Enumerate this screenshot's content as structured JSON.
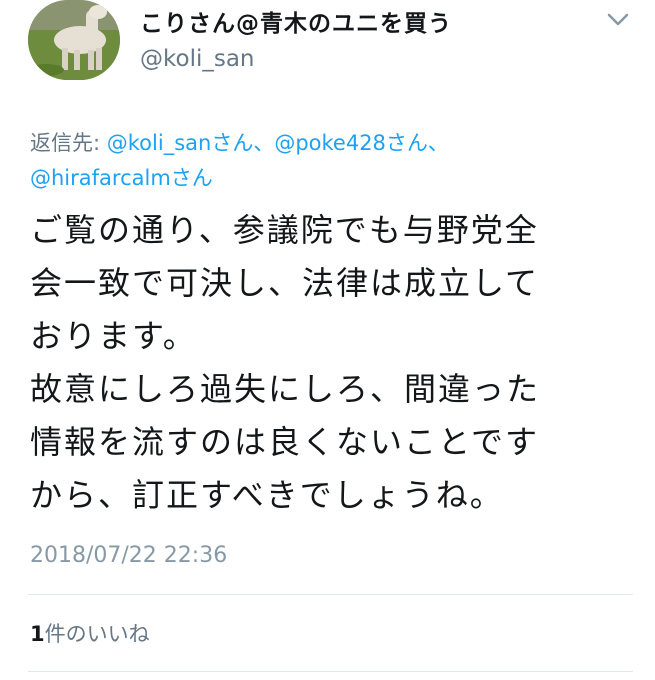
{
  "author": {
    "display_name": "こりさん@青木のユニを買う",
    "handle": "@koli_san"
  },
  "reply_to": {
    "prefix": "返信先: ",
    "mentions": [
      {
        "handle": "@koli_san",
        "suffix": "さん、"
      },
      {
        "handle": "@poke428",
        "suffix": "さん、"
      },
      {
        "handle": "@hirafarcalm",
        "suffix": "さん"
      }
    ]
  },
  "body": {
    "lines": [
      "ご覧の通り、参議院でも与野党全",
      "会一致で可決し、法律は成立して",
      "おります。",
      "故意にしろ過失にしろ、間違った",
      "情報を流すのは良くないことです",
      "から、訂正すべきでしょうね。"
    ]
  },
  "timestamp": "2018/07/22 22:36",
  "likes": {
    "count": "1",
    "label": "件のいいね"
  },
  "icons": {
    "menu": "chevron-down-icon",
    "avatar": "alpaca-photo"
  }
}
